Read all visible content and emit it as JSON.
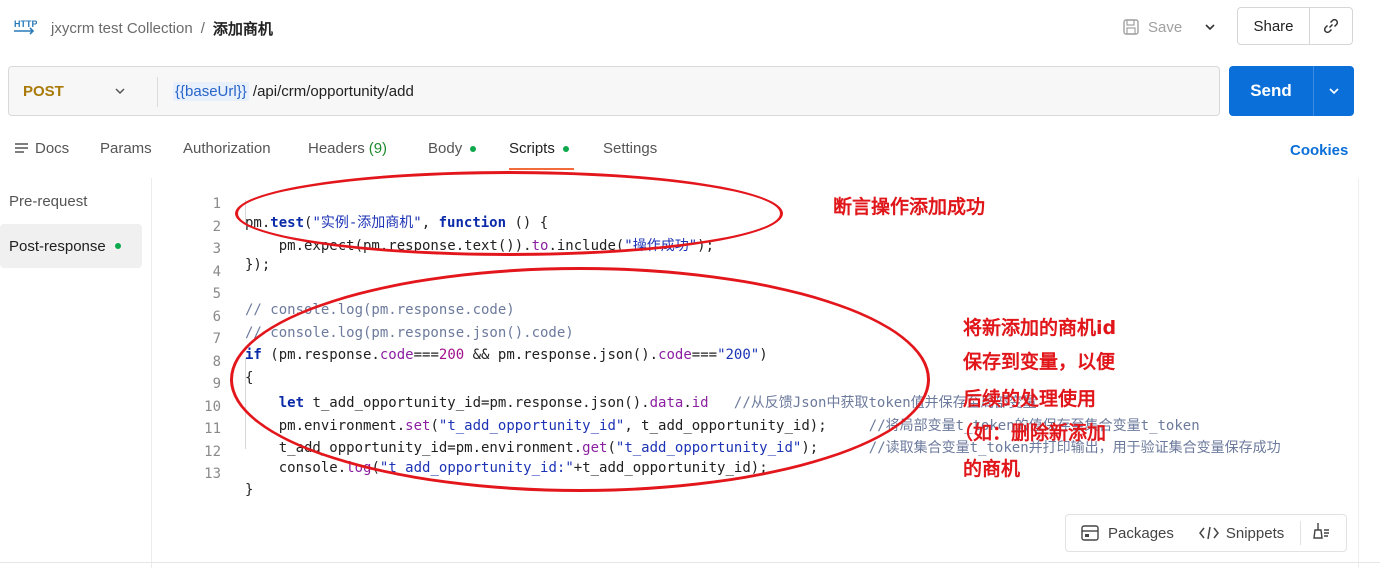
{
  "header": {
    "http_icon_label": "HTTP",
    "collection": "jxycrm test Collection",
    "separator": "/",
    "request_name": "添加商机",
    "save_label": "Save",
    "share_label": "Share"
  },
  "url_bar": {
    "method": "POST",
    "url_variable": "{{baseUrl}}",
    "url_path": " /api/crm/opportunity/add",
    "send_label": "Send"
  },
  "tabs": {
    "docs": "Docs",
    "params": "Params",
    "authorization": "Authorization",
    "headers": "Headers",
    "headers_count": "(9)",
    "body": "Body",
    "scripts": "Scripts",
    "settings": "Settings",
    "cookies": "Cookies"
  },
  "subnav": {
    "pre_request": "Pre-request",
    "post_response": "Post-response"
  },
  "code": {
    "line_numbers": [
      "1",
      "2",
      "3",
      "4",
      "5",
      "6",
      "7",
      "8",
      "9",
      "10",
      "11",
      "12",
      "13"
    ],
    "l1": [
      "pm.",
      "test",
      "(",
      "\"实例-添加商机\"",
      ", ",
      "function",
      " () {"
    ],
    "l2": [
      "    pm.expect(pm.response.text()).",
      "to",
      ".include(",
      "\"操作成功\"",
      ");"
    ],
    "l3": "});",
    "l5": "// console.log(pm.response.code)",
    "l6": "// console.log(pm.response.json().code)",
    "l7": [
      "if",
      " (pm.response.",
      "code",
      "===",
      "200",
      " && pm.response.json().",
      "code",
      "===",
      "\"200\"",
      ")"
    ],
    "l8": "{",
    "l9": [
      "    ",
      "let",
      " t_add_opportunity_id=pm.response.json().",
      "data",
      ".",
      "id",
      "   ",
      "//从反馈Json中获取token值并保存至局部变量"
    ],
    "l10": [
      "    pm.environment.",
      "set",
      "(",
      "\"t_add_opportunity_id\"",
      ", t_add_opportunity_id);",
      "     ",
      "//将局部变量t_token的值保存至集合变量t_token"
    ],
    "l11": [
      "    t_add_opportunity_id=pm.environment.",
      "get",
      "(",
      "\"t_add_opportunity_id\"",
      ");",
      "      ",
      "//读取集合变量t_token并打印输出，用于验证集合变量保存成功"
    ],
    "l12": [
      "    console.",
      "log",
      "(",
      "\"t_add_opportunity_id:\"",
      "+t_add_opportunity_id);"
    ],
    "l13": "}"
  },
  "annotations": {
    "a1": "断言操作添加成功",
    "a2_l1": "将新添加的商机id",
    "a2_l2": "保存到变量，以便",
    "a2_l3": "后续的处理使用",
    "a2_l4": "（如：删除新添加",
    "a2_l5": "的商机"
  },
  "bottom_bar": {
    "packages": "Packages",
    "snippets": "Snippets"
  },
  "colors": {
    "send": "#0a6fd9",
    "post_method": "#a97a07",
    "status_dot": "#0ca84b",
    "active_tab_underline": "#f26b3a",
    "annotation_red": "#e3161c"
  },
  "icons": [
    "http-icon",
    "save-icon",
    "chevron-down-icon",
    "link-icon",
    "docs-icon",
    "package-icon",
    "code-icon",
    "broom-icon"
  ]
}
